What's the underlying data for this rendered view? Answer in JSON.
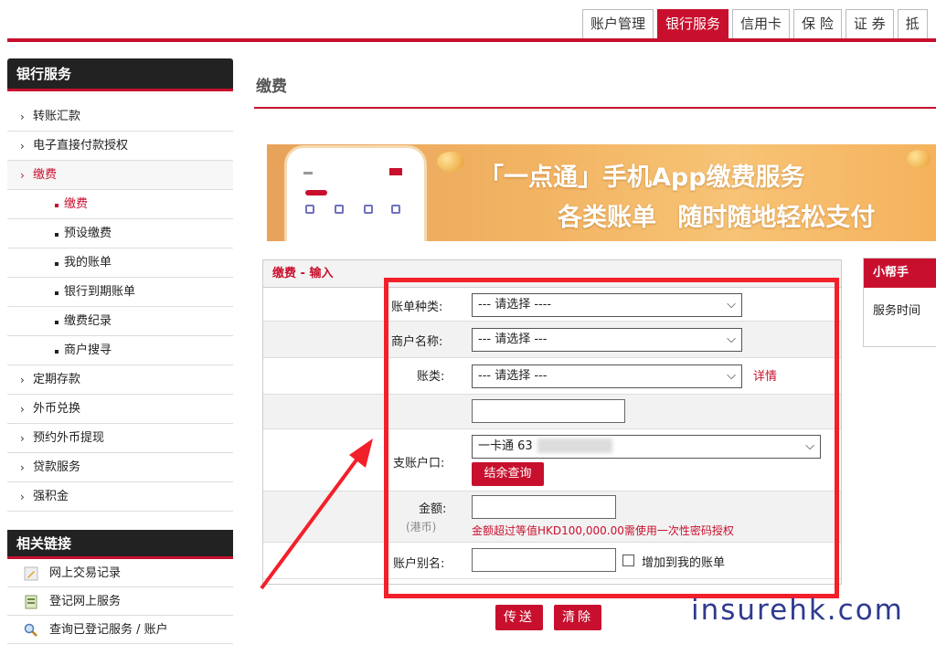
{
  "top_tabs": [
    {
      "label": "账户管理",
      "active": false
    },
    {
      "label": "银行服务",
      "active": true
    },
    {
      "label": "信用卡",
      "active": false
    },
    {
      "label": "保 险",
      "active": false
    },
    {
      "label": "证 券",
      "active": false
    },
    {
      "label": "抵",
      "active": false
    }
  ],
  "sidebar": {
    "title": "银行服务",
    "items": [
      {
        "label": "转账汇款"
      },
      {
        "label": "电子直接付款授权"
      },
      {
        "label": "缴费"
      },
      {
        "label": "定期存款"
      },
      {
        "label": "外币兑换"
      },
      {
        "label": "预约外币提现"
      },
      {
        "label": "贷款服务"
      },
      {
        "label": "强积金"
      }
    ],
    "sub_items": [
      {
        "label": "缴费"
      },
      {
        "label": "预设缴费"
      },
      {
        "label": "我的账单"
      },
      {
        "label": "银行到期账单"
      },
      {
        "label": "缴费纪录"
      },
      {
        "label": "商户搜寻"
      }
    ],
    "chevron": "›"
  },
  "related_links": {
    "title": "相关链接",
    "items": [
      {
        "label": "网上交易记录",
        "icon": "pencil-icon"
      },
      {
        "label": "登记网上服务",
        "icon": "register-icon"
      },
      {
        "label": "查询已登记服务 / 账户",
        "icon": "magnifier-icon"
      }
    ]
  },
  "page_title": "缴费",
  "banner": {
    "line1": "「一点通」手机App缴费服务",
    "line2": "各类账单 随时随地轻松支付"
  },
  "form": {
    "header": "缴费 - 输入",
    "bill_type": {
      "label": "账单种类:",
      "value": "--- 请选择 ----"
    },
    "merchant": {
      "label": "商户名称:",
      "value": "--- 请选择 ---"
    },
    "account_type": {
      "label": "账类:",
      "value": "--- 请选择 ---",
      "detail_link": "详情"
    },
    "pay_account": {
      "label": "支账户口:",
      "value": "一卡通 63",
      "balance_button": "结余查询"
    },
    "amount": {
      "label": "金额:",
      "currency": "(港币)",
      "hint": "金额超过等值HKD100,000.00需使用一次性密码授权"
    },
    "alias": {
      "label": "账户别名:",
      "checkbox_label": "增加到我的账单"
    }
  },
  "actions": {
    "submit": "传送",
    "clear": "清除"
  },
  "helper": {
    "title": "小帮手",
    "item": "服务时间"
  },
  "watermark": "insurehk.com",
  "colors": {
    "brand_red": "#c8102e",
    "highlight": "#f2202a",
    "watermark": "#2e3b8f"
  }
}
